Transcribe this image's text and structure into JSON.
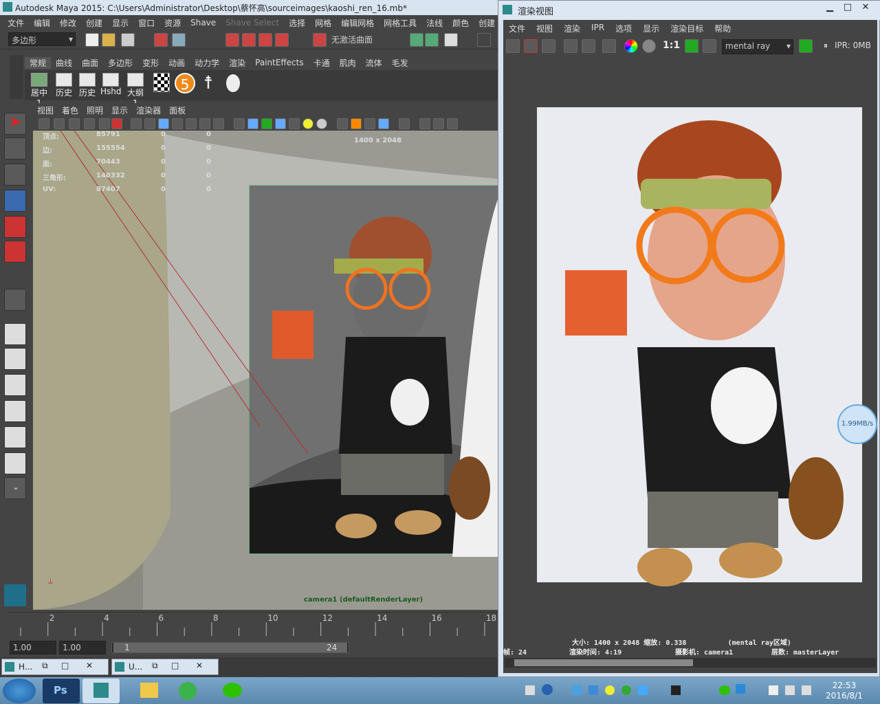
{
  "maya": {
    "title": "Autodesk Maya 2015: C:\\Users\\Administrator\\Desktop\\蔡怀高\\sourceimages\\kaoshi_ren_16.mb*",
    "menu": [
      "文件",
      "编辑",
      "修改",
      "创建",
      "显示",
      "窗口",
      "资源",
      "Shave",
      "Shave Select",
      "选择",
      "网格",
      "编辑网格",
      "网格工具",
      "法线",
      "颜色",
      "创建"
    ],
    "mode_dropdown": "多边形",
    "live_surface": "无激活曲面",
    "shelf_tabs": [
      "常规",
      "曲线",
      "曲面",
      "多边形",
      "变形",
      "动画",
      "动力学",
      "渲染",
      "PaintEffects",
      "卡通",
      "肌肉",
      "流体",
      "毛发"
    ],
    "shelf_icons": [
      "居中1",
      "历史",
      "历史",
      "Hshd",
      "大纲1"
    ],
    "panel_menu": [
      "视图",
      "着色",
      "照明",
      "显示",
      "渲染器",
      "面板"
    ],
    "hud": {
      "rows": [
        {
          "label": "顶点:",
          "v1": "85791",
          "v2": "0",
          "v3": "0"
        },
        {
          "label": "边:",
          "v1": "155554",
          "v2": "0",
          "v3": "0"
        },
        {
          "label": "面:",
          "v1": "70443",
          "v2": "0",
          "v3": "0"
        },
        {
          "label": "三角形:",
          "v1": "140332",
          "v2": "0",
          "v3": "0"
        },
        {
          "label": "UV:",
          "v1": "87407",
          "v2": "0",
          "v3": "0"
        }
      ],
      "resolution": "1400 x 2048",
      "camera": "camera1 (defaultRenderLayer)"
    },
    "timeline_ticks": [
      "2",
      "4",
      "6",
      "8",
      "10",
      "12",
      "14",
      "16",
      "18"
    ],
    "range_start": "1.00",
    "range_start2": "1.00",
    "range_slider_start": "1",
    "range_slider_end": "24"
  },
  "task_windows": [
    {
      "label": "H..."
    },
    {
      "label": "U..."
    }
  ],
  "render_view": {
    "title": "渲染视图",
    "menu": [
      "文件",
      "视图",
      "渲染",
      "IPR",
      "选项",
      "显示",
      "渲染目标",
      "帮助"
    ],
    "ratio": "1:1",
    "renderer": "mental ray",
    "ipr": "IPR: 0MB",
    "status_line1": "大小: 1400 x 2048 缩放: 0.338          (mental ray区域)",
    "status_line2_frame": "帧: 24",
    "status_line2_time": "渲染时间:  4:19",
    "status_line2_camera": "摄影机: camera1",
    "status_line2_layer": "层数: masterLayer"
  },
  "net_speed": "1.99MB/s",
  "clock": {
    "time": "22:53",
    "date": "2016/8/1"
  }
}
